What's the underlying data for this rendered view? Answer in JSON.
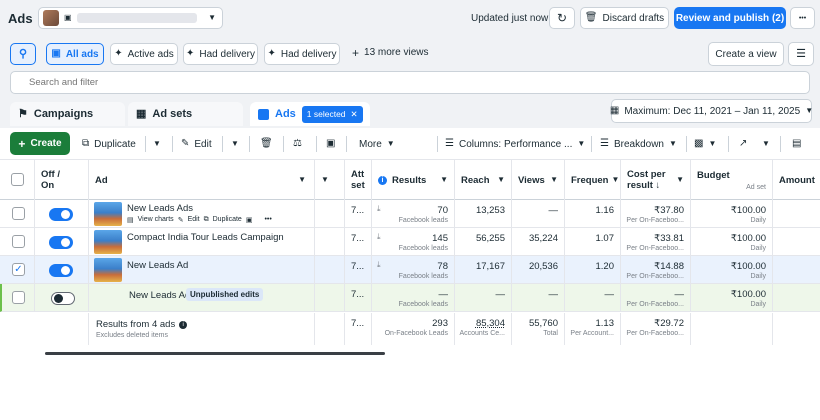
{
  "header": {
    "title": "Ads",
    "updated": "Updated just now",
    "discard": "Discard drafts",
    "review": "Review and publish (2)",
    "more": "•••"
  },
  "views": {
    "all": "All ads",
    "active": "Active ads",
    "had1": "Had delivery",
    "had2": "Had delivery",
    "more": "13 more views",
    "create": "Create a view"
  },
  "search": {
    "placeholder": "Search and filter"
  },
  "tabs": {
    "campaigns": "Campaigns",
    "adsets": "Ad sets",
    "ads": "Ads",
    "selected": "1 selected",
    "date": "Maximum: Dec 11, 2021 – Jan 11, 2025"
  },
  "toolbar": {
    "create": "Create",
    "duplicate": "Duplicate",
    "edit": "Edit",
    "more": "More",
    "columns": "Columns: Performance ...",
    "breakdown": "Breakdown"
  },
  "columns": {
    "offon": [
      "Off /",
      "On"
    ],
    "ad": "Ad",
    "att": [
      "Att",
      "set"
    ],
    "results": "Results",
    "reach": "Reach",
    "views": "Views",
    "freq": "Frequen",
    "cpr": [
      "Cost per",
      "result ↓"
    ],
    "budget": "Budget",
    "budget_sub": "Ad set",
    "amount": "Amount"
  },
  "rows": [
    {
      "name": "New Leads Ads",
      "att": "7...",
      "results": "70",
      "results_sub": "Facebook leads",
      "reach": "13,253",
      "views": "—",
      "freq": "1.16",
      "cpr": "₹37.80",
      "cpr_sub": "Per On-Faceboo...",
      "budget": "₹100.00",
      "budget_sub": "Daily",
      "actions": {
        "charts": "View charts",
        "edit": "Edit",
        "dup": "Duplicate"
      }
    },
    {
      "name": "Compact India Tour Leads Campaign",
      "att": "7...",
      "results": "145",
      "results_sub": "Facebook leads",
      "reach": "56,255",
      "views": "35,224",
      "freq": "1.07",
      "cpr": "₹33.81",
      "cpr_sub": "Per On-Faceboo...",
      "budget": "₹100.00",
      "budget_sub": "Daily"
    },
    {
      "name": "New Leads Ad",
      "att": "7...",
      "results": "78",
      "results_sub": "Facebook leads",
      "reach": "17,167",
      "views": "20,536",
      "freq": "1.20",
      "cpr": "₹14.88",
      "cpr_sub": "Per On-Faceboo...",
      "budget": "₹100.00",
      "budget_sub": "Daily"
    },
    {
      "name": "New Leads Ad",
      "badge": "Unpublished edits",
      "att": "7...",
      "results": "—",
      "results_sub": "Facebook leads",
      "reach": "—",
      "views": "—",
      "freq": "—",
      "cpr": "—",
      "cpr_sub": "Per On-Faceboo...",
      "budget": "₹100.00",
      "budget_sub": "Daily"
    }
  ],
  "summary": {
    "label": "Results from 4 ads",
    "sub": "Excludes deleted items",
    "att": "7...",
    "results": "293",
    "results_sub": "On-Facebook Leads",
    "reach": "85,304",
    "reach_sub": "Accounts Ce...",
    "views": "55,760",
    "views_sub": "Total",
    "freq": "1.13",
    "freq_sub": "Per Account...",
    "cpr": "₹29.72",
    "cpr_sub": "Per On-Faceboo..."
  },
  "colors": {
    "accent": "#1877f2",
    "create": "#1b7d3a",
    "selected_row": "#eaf2fd",
    "draft_row": "#eef7ea"
  }
}
